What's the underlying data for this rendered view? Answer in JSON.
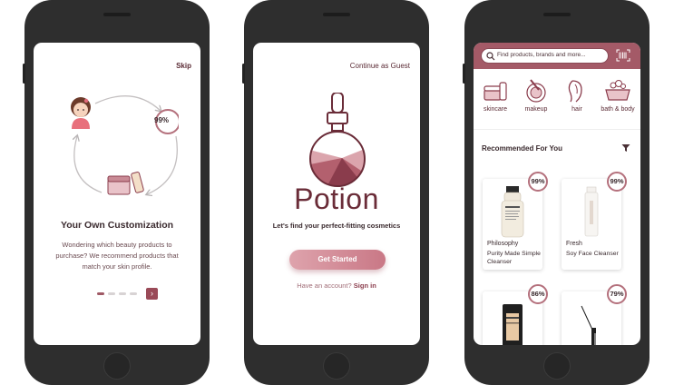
{
  "onboarding": {
    "skip_label": "Skip",
    "match_badge": "99%",
    "title": "Your Own Customization",
    "description": "Wondering which beauty products to purchase? We recommend products that match your skin profile.",
    "next_icon": "chevron-right-icon"
  },
  "welcome": {
    "guest_label": "Continue as Guest",
    "brand_name": "Potion",
    "tagline": "Let's find your perfect-fitting cosmetics",
    "cta_label": "Get Started",
    "account_prompt": "Have an account?",
    "signin_label": "Sign in"
  },
  "home": {
    "search_placeholder": "Find products, brands and more...",
    "categories": [
      {
        "label": "skincare",
        "icon": "skincare-icon"
      },
      {
        "label": "makeup",
        "icon": "makeup-icon"
      },
      {
        "label": "hair",
        "icon": "hair-icon"
      },
      {
        "label": "bath & body",
        "icon": "bath-body-icon"
      }
    ],
    "section_title": "Recommended For You",
    "products": [
      {
        "match": "99%",
        "brand": "Philosophy",
        "name": "Purity Made Simple Cleanser"
      },
      {
        "match": "99%",
        "brand": "Fresh",
        "name": "Soy Face Cleanser"
      },
      {
        "match": "86%",
        "brand": "",
        "name": ""
      },
      {
        "match": "79%",
        "brand": "",
        "name": ""
      }
    ]
  },
  "colors": {
    "accent": "#a45a67",
    "brand_text": "#6a2c38",
    "phone_body": "#2e2e2e"
  }
}
